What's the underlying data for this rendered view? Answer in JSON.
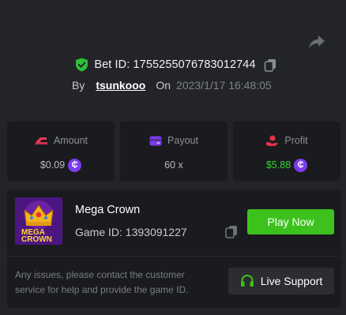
{
  "bet": {
    "label": "Bet ID: 1755255076783012744",
    "by_label": "By",
    "username": "tsunkooo",
    "on_label": "On",
    "date": "2023/1/17 16:48:05"
  },
  "stats": {
    "amount": {
      "label": "Amount",
      "value": "$0.09"
    },
    "payout": {
      "label": "Payout",
      "value": "60 x"
    },
    "profit": {
      "label": "Profit",
      "value": "$5.88"
    }
  },
  "game": {
    "name": "Mega Crown",
    "id_label": "Game ID: 1393091227",
    "play_label": "Play Now",
    "thumb_title_1": "MEGA",
    "thumb_title_2": "CROWN"
  },
  "support": {
    "message": "Any issues, please contact the customer service for help and provide the game ID.",
    "button_label": "Live Support"
  },
  "colors": {
    "accent_green": "#3dc21d",
    "profit_green": "#36d432",
    "coin_purple": "#7d3cf0",
    "amount_pink": "#e8365a",
    "payout_purple": "#7b3bea",
    "profit_red": "#e0334a",
    "shield_green": "#2fbf3a"
  },
  "icons": {
    "share": "share-icon",
    "shield": "shield-check-icon",
    "copy": "copy-icon",
    "coin": "coin-icon",
    "headset": "headset-icon"
  }
}
